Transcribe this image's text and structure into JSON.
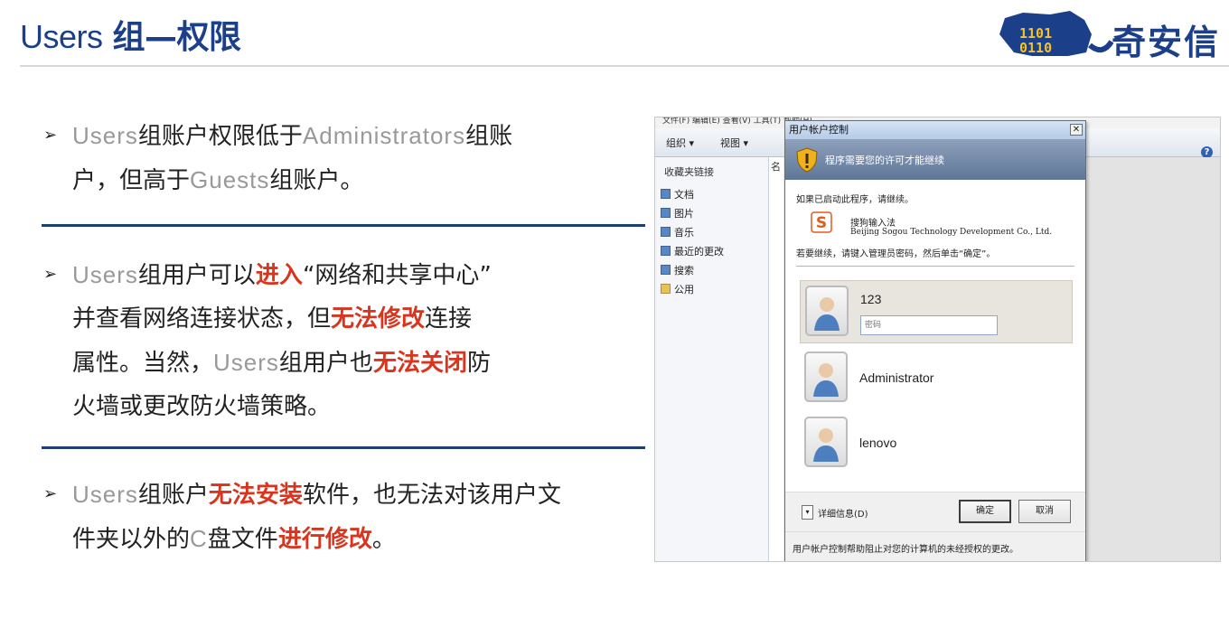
{
  "header": {
    "title_latin": "Users",
    "title_cjk": "组—权限",
    "logo_text": "奇安信",
    "logo_binary": "1101\n0110"
  },
  "bullets": [
    {
      "lines": [
        [
          {
            "t": "Users",
            "s": "latin"
          },
          {
            "t": "组账户权限低于"
          },
          {
            "t": "Administrators",
            "s": "latin"
          },
          {
            "t": "组账"
          }
        ],
        [
          {
            "t": "户，但高于"
          },
          {
            "t": "Guests",
            "s": "latin"
          },
          {
            "t": "组账户。"
          }
        ]
      ]
    },
    {
      "lines": [
        [
          {
            "t": "Users",
            "s": "latin"
          },
          {
            "t": "组用户可以"
          },
          {
            "t": "进入",
            "s": "hl"
          },
          {
            "t": "“网络和共享中心”"
          }
        ],
        [
          {
            "t": "并查看网络连接状态，但"
          },
          {
            "t": "无法修改",
            "s": "hl"
          },
          {
            "t": "连接"
          }
        ],
        [
          {
            "t": "属性。当然，"
          },
          {
            "t": "Users",
            "s": "latin"
          },
          {
            "t": "组用户也"
          },
          {
            "t": "无法关闭",
            "s": "hl"
          },
          {
            "t": "防"
          }
        ],
        [
          {
            "t": "火墙或更改防火墙策略。"
          }
        ]
      ]
    },
    {
      "lines": [
        [
          {
            "t": "Users",
            "s": "latin"
          },
          {
            "t": "组账户"
          },
          {
            "t": "无法安装",
            "s": "hl"
          },
          {
            "t": "软件，也无法对该用户文"
          }
        ],
        [
          {
            "t": "件夹以外的"
          },
          {
            "t": "C",
            "s": "latin"
          },
          {
            "t": "盘文件"
          },
          {
            "t": "进行修改",
            "s": "hl"
          },
          {
            "t": "。"
          }
        ]
      ]
    }
  ],
  "explorer": {
    "menubar": "文件(F)    编辑(E)    查看(V)    工具(T)    帮助(H)",
    "toolbar": {
      "organize": "组织 ▾",
      "views": "视图 ▾"
    },
    "nav_heading": "收藏夹链接",
    "nav_items": [
      "文档",
      "图片",
      "音乐",
      "最近的更改",
      "搜索",
      "公用"
    ],
    "column_header": "名"
  },
  "uac": {
    "title": "用户帐户控制",
    "close": "✕",
    "banner": "程序需要您的许可才能继续",
    "intro": "如果已启动此程序，请继续。",
    "app_name": "搜狗输入法",
    "app_publisher": "Beijing Sogou Technology Development Co., Ltd.",
    "prompt": "若要继续，请键入管理员密码，然后单击“确定”。",
    "users": [
      {
        "name": "123",
        "selected": true,
        "password_placeholder": "密码"
      },
      {
        "name": "Administrator",
        "selected": false
      },
      {
        "name": "lenovo",
        "selected": false
      }
    ],
    "details_toggle": "▾",
    "details_label": "详细信息(D)",
    "ok": "确定",
    "cancel": "取消",
    "footer": "用户帐户控制帮助阻止对您的计算机的未经授权的更改。"
  },
  "colors": {
    "title_blue": "#1c3f8a",
    "highlight_red": "#d9351e",
    "divider_navy": "#1e3f73",
    "latin_gray": "#999999"
  }
}
